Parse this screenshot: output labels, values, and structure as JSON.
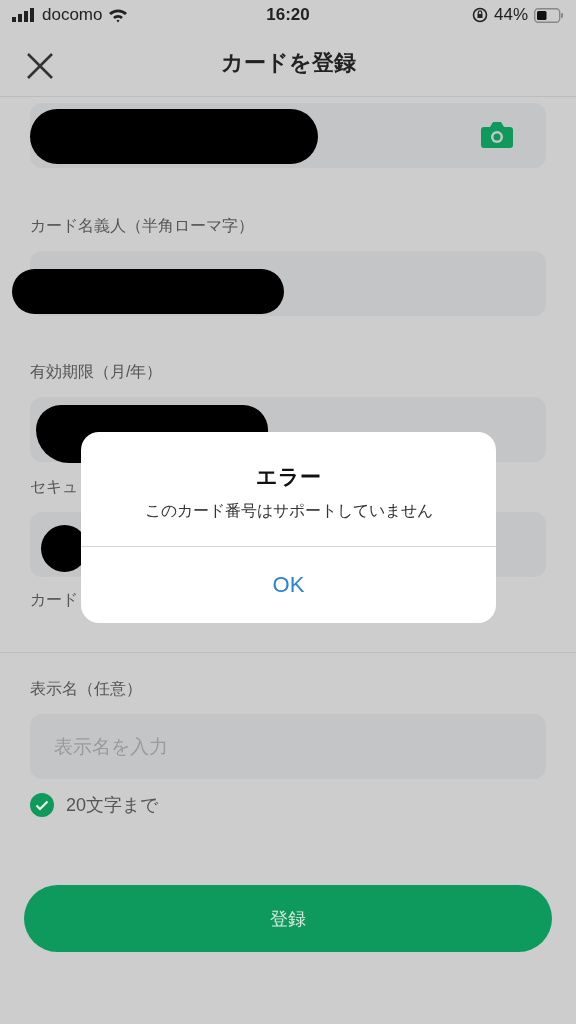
{
  "status_bar": {
    "carrier": "docomo",
    "time": "16:20",
    "battery": "44%"
  },
  "header": {
    "title": "カードを登録"
  },
  "form": {
    "fields": [
      {
        "kind": "card_number",
        "redacted": true
      },
      {
        "kind": "text",
        "label": "カード名義人（半角ローマ字）",
        "redacted": true
      },
      {
        "kind": "text",
        "label": "有効期限（月/年）",
        "redacted": true
      },
      {
        "kind": "text",
        "label": "セキュ",
        "redacted": true
      },
      {
        "kind": "label",
        "label": "カード"
      }
    ],
    "display_name": {
      "label": "表示名（任意）",
      "placeholder": "表示名を入力",
      "hint": "20文字まで",
      "checked": true
    },
    "submit": "登録"
  },
  "dialog": {
    "title": "エラー",
    "message": "このカード番号はサポートしていません",
    "button": "OK"
  }
}
